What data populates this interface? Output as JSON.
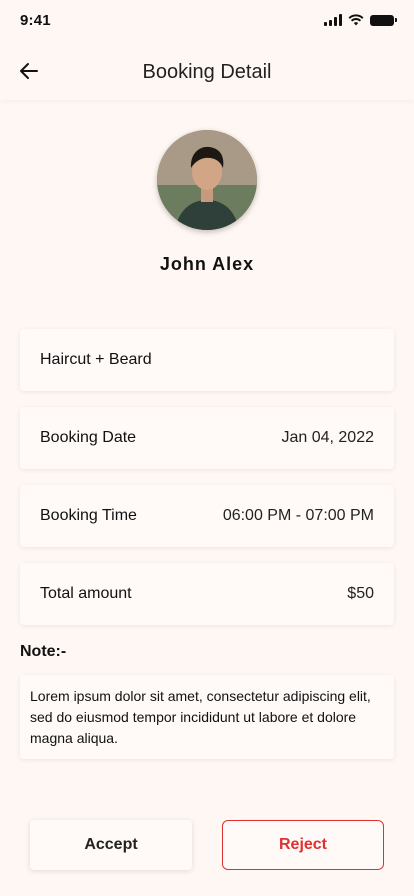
{
  "status_bar": {
    "time": "9:41"
  },
  "header": {
    "title": "Booking Detail"
  },
  "customer": {
    "name": "John Alex"
  },
  "service": {
    "label": "Haircut + Beard"
  },
  "booking_date": {
    "label": "Booking Date",
    "value": "Jan 04, 2022"
  },
  "booking_time": {
    "label": "Booking Time",
    "value": "06:00 PM - 07:00 PM"
  },
  "total_amount": {
    "label": "Total amount",
    "value": "$50"
  },
  "note": {
    "label": "Note:-",
    "text": "Lorem ipsum dolor sit amet, consectetur adipiscing elit, sed do eiusmod tempor incididunt ut labore et dolore magna aliqua."
  },
  "actions": {
    "accept_label": "Accept",
    "reject_label": "Reject"
  },
  "colors": {
    "background": "#fff7f3",
    "reject": "#e03131"
  }
}
